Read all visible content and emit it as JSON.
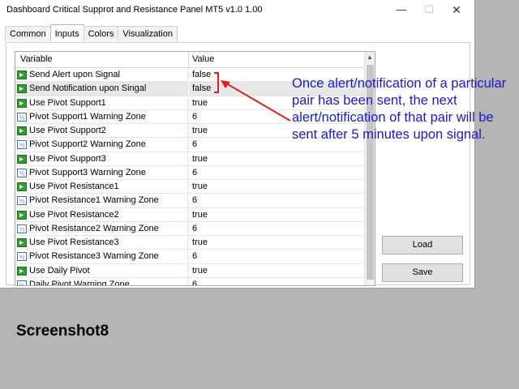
{
  "window": {
    "title": "Dashboard Critical Supprot and Resistance Panel MT5 v1.0 1.00",
    "minimize_glyph": "—",
    "maximize_glyph": "☐",
    "close_glyph": "✕"
  },
  "tabs": [
    {
      "label": "Common"
    },
    {
      "label": "Inputs"
    },
    {
      "label": "Colors"
    },
    {
      "label": "Visualization"
    }
  ],
  "active_tab": "Inputs",
  "grid": {
    "col_variable": "Variable",
    "col_value": "Value",
    "rows": [
      {
        "icon": "bool-icon",
        "variable": "Send Alert upon Signal",
        "value": "false"
      },
      {
        "icon": "bool-icon",
        "variable": "Send Notification upon Singal",
        "value": "false"
      },
      {
        "icon": "bool-icon",
        "variable": "Use Pivot Support1",
        "value": "true"
      },
      {
        "icon": "number-icon",
        "variable": "Pivot Support1 Warning Zone",
        "value": "6"
      },
      {
        "icon": "bool-icon",
        "variable": "Use Pivot Support2",
        "value": "true"
      },
      {
        "icon": "number-icon",
        "variable": "Pivot Support2 Warning Zone",
        "value": "6"
      },
      {
        "icon": "bool-icon",
        "variable": "Use Pivot Support3",
        "value": "true"
      },
      {
        "icon": "number-icon",
        "variable": "Pivot Support3 Warning Zone",
        "value": "6"
      },
      {
        "icon": "bool-icon",
        "variable": "Use Pivot Resistance1",
        "value": "true"
      },
      {
        "icon": "number-icon",
        "variable": "Pivot Resistance1 Warning Zone",
        "value": "6"
      },
      {
        "icon": "bool-icon",
        "variable": "Use Pivot Resistance2",
        "value": "true"
      },
      {
        "icon": "number-icon",
        "variable": "Pivot Resistance2 Warning Zone",
        "value": "6"
      },
      {
        "icon": "bool-icon",
        "variable": "Use Pivot Resistance3",
        "value": "true"
      },
      {
        "icon": "number-icon",
        "variable": "Pivot Resistance3 Warning Zone",
        "value": "6"
      },
      {
        "icon": "bool-icon",
        "variable": "Use Daily Pivot",
        "value": "true"
      },
      {
        "icon": "number-icon",
        "variable": "Daily Pivot Warning Zone",
        "value": "6"
      }
    ]
  },
  "buttons": {
    "load": "Load",
    "save": "Save"
  },
  "annotation": {
    "text": "Once alert/notification of a particular pair has been sent, the next alert/notification of that pair will be sent after 5 minutes upon signal.",
    "color": "#1a1acc",
    "marker_color": "#e02020"
  },
  "caption": "Screenshot8",
  "colors": {
    "bool_icon": "#2e9e2e",
    "number_icon": "#3a6fd8",
    "background": "#b6b4b4"
  }
}
